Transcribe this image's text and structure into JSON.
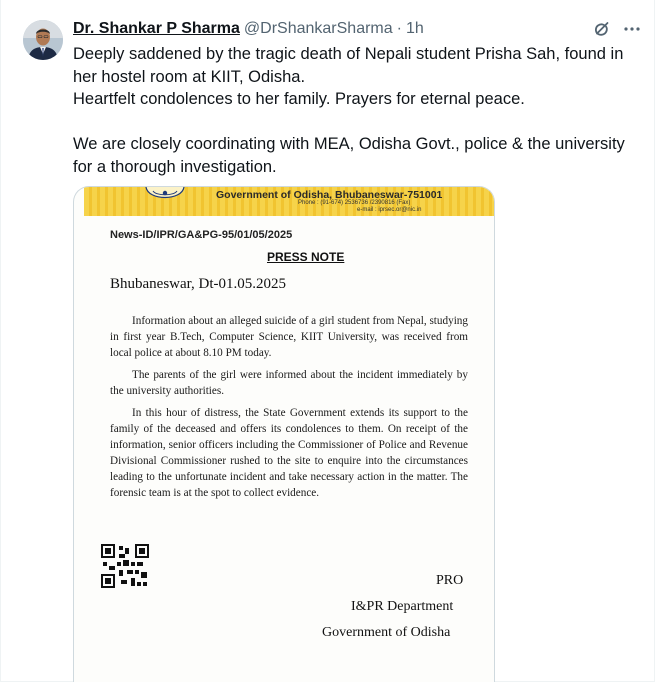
{
  "post": {
    "author": {
      "display_name": "Dr. Shankar P Sharma",
      "handle": "@DrShankarSharma",
      "separator": "·",
      "time": "1h"
    },
    "icons": {
      "grok": "grok-icon",
      "more": "more-icon"
    },
    "text_lines": [
      "Deeply saddened by the tragic death of Nepali student Prisha Sah, found in her hostel room at KIIT, Odisha.",
      "Heartfelt condolences to her family. Prayers for eternal peace.",
      "We are closely coordinating with MEA, Odisha Govt., police & the university for a thorough investigation."
    ]
  },
  "document": {
    "header": {
      "org_name": "Government of Odisha, Bhubaneswar-751001",
      "phone": "Phone : (91-674) 2536736 /2390816 (Fax)",
      "email": "e-mail : iprsec.or@nic.in"
    },
    "reference": "News-ID/IPR/GA&PG-95/01/05/2025",
    "title": "PRESS NOTE",
    "dateline": "Bhubaneswar, Dt-01.05.2025",
    "paragraphs": [
      "Information about an alleged suicide of a girl student from Nepal, studying in first year B.Tech, Computer Science, KIIT University, was received from local police at about 8.10 PM today.",
      "The parents of the girl were informed about the incident immediately by the university authorities.",
      "In this hour of distress, the State Government extends its support to the family of the deceased and offers its condolences to them. On receipt of the information, senior officers including the Commissioner of Police and Revenue Divisional Commissioner rushed to the site to enquire into the circumstances leading to the unfortunate incident and take necessary action in the matter. The forensic team is at the spot to collect evidence."
    ],
    "signature": {
      "line1": "PRO",
      "line2": "I&PR Department",
      "line3": "Government of Odisha"
    }
  },
  "colors": {
    "text_primary": "#0f1419",
    "text_secondary": "#536471",
    "banner_yellow": "#f6d34a",
    "border": "#cfd9de"
  }
}
